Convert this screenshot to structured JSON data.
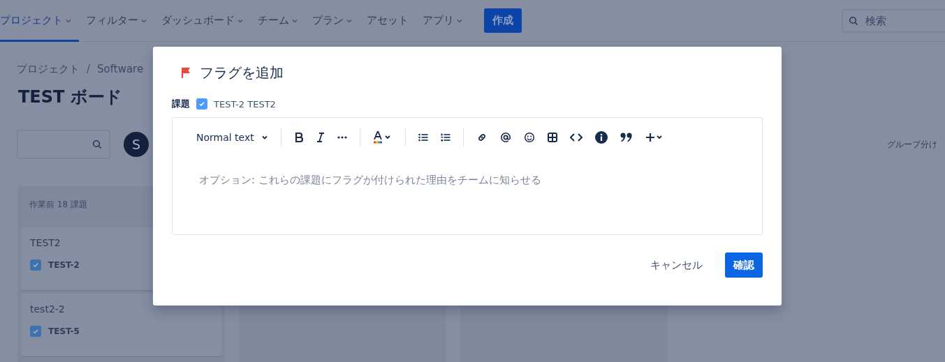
{
  "nav": {
    "items": [
      {
        "label": "プロジェクト",
        "dropdown": true,
        "selected": true
      },
      {
        "label": "フィルター",
        "dropdown": true,
        "selected": false
      },
      {
        "label": "ダッシュボード",
        "dropdown": true,
        "selected": false
      },
      {
        "label": "チーム",
        "dropdown": true,
        "selected": false
      },
      {
        "label": "プラン",
        "dropdown": true,
        "selected": false
      },
      {
        "label": "アセット",
        "dropdown": false,
        "selected": false
      },
      {
        "label": "アプリ",
        "dropdown": true,
        "selected": false
      }
    ],
    "create_button": "作成",
    "search": {
      "placeholder": "検索"
    }
  },
  "breadcrumb": [
    {
      "kind": "link",
      "text": "プロジェクト"
    },
    {
      "kind": "separator",
      "text": "/"
    },
    {
      "kind": "link",
      "text": "Software"
    }
  ],
  "board_title": "TEST ボード",
  "avatar": "S",
  "group_by": "グループ分け",
  "columns": [
    {
      "header": "作業前 18 課題",
      "cards": [
        {
          "title": "TEST2",
          "key": "TEST-2",
          "checked": true
        },
        {
          "title": "test2-2",
          "key": "TEST-5",
          "checked": true
        }
      ]
    },
    {},
    {}
  ],
  "dialog": {
    "title": "フラグを追加",
    "issue_label": "課題",
    "issue": {
      "text": "TEST-2 TEST2",
      "checked": true
    },
    "editor": {
      "text_style": "Normal text",
      "placeholder": "オプション: これらの課題にフラグが付けられた理由をチームに知らせる"
    },
    "buttons": [
      {
        "label": "キャンセル",
        "kind": "subtle"
      },
      {
        "label": "確認",
        "kind": "primary"
      }
    ]
  }
}
